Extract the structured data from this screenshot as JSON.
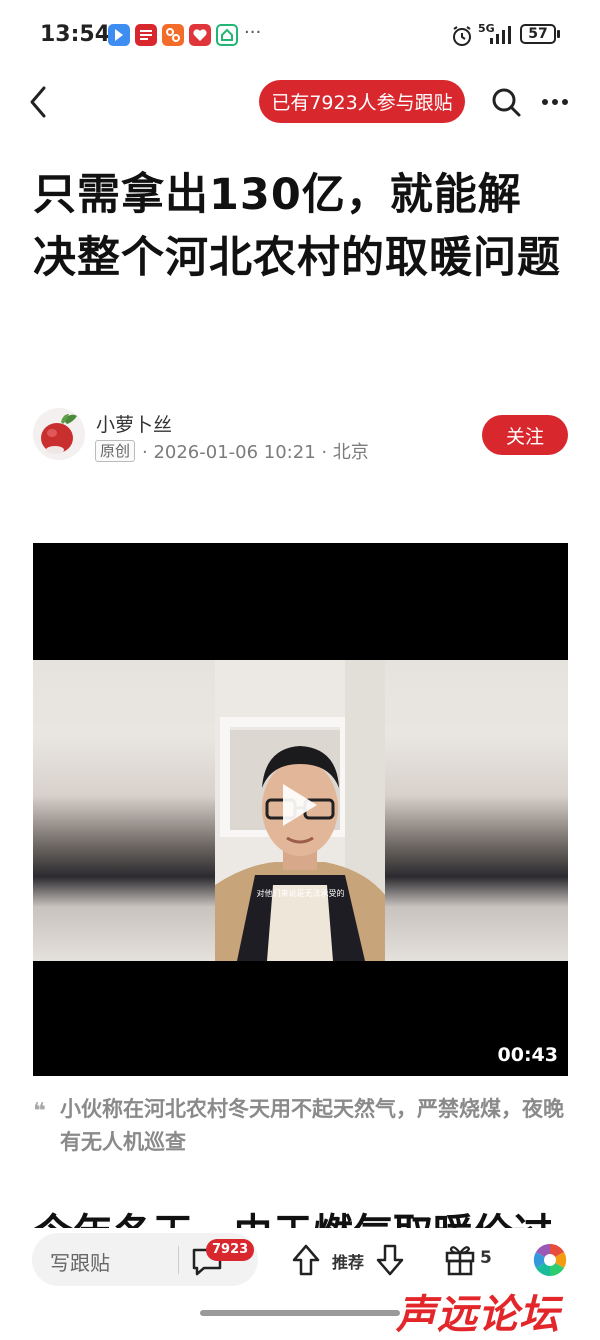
{
  "status_bar": {
    "time": "13:54",
    "more": "···",
    "network": "5G",
    "battery": "57",
    "app_icons": [
      "bird-app-icon",
      "netease-news-icon",
      "orange-app-icon",
      "charity-app-icon",
      "green-home-app-icon"
    ]
  },
  "header": {
    "participate_text": "已有7923人参与跟贴"
  },
  "article": {
    "title": "只需拿出130亿，就能解决整个河北农村的取暖问题",
    "author": "小萝卜丝",
    "original_badge": "原创",
    "meta": "· 2026-01-06 10:21 · 北京",
    "follow_label": "关注"
  },
  "video": {
    "duration": "00:43",
    "subtitle": "对他们来说是无法承受的"
  },
  "caption": "小伙称在河北农村冬天用不起天然气，严禁烧煤，夜晚有无人机巡查",
  "next_text_partial": "今年冬天，由于燃气取暖价过",
  "bottom_bar": {
    "reply_placeholder": "写跟贴",
    "comment_count": "7923",
    "recommend_label": "推荐",
    "gift_count": "5"
  },
  "watermark": "声远论坛",
  "colors": {
    "accent_red": "#d9272e"
  }
}
